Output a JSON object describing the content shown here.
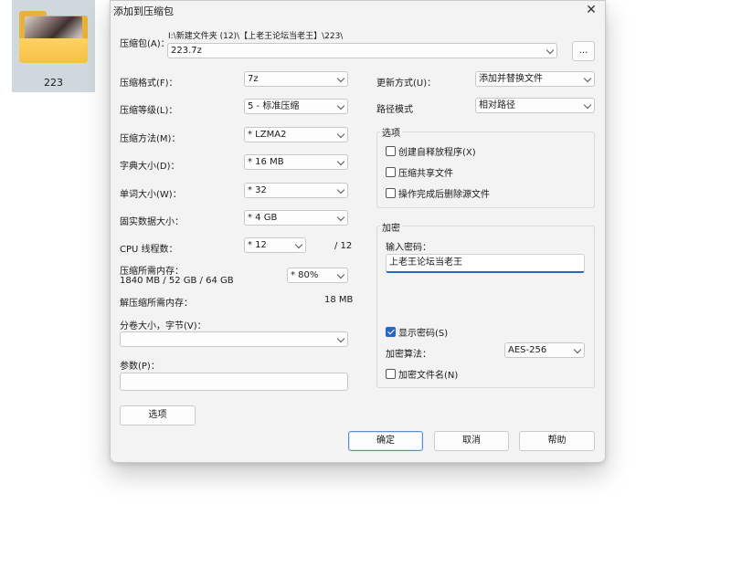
{
  "desktop": {
    "folder_name": "223"
  },
  "dialog": {
    "title": "添加到压缩包",
    "close_glyph": "✕",
    "archive": {
      "label": "压缩包(A)：",
      "path": "I:\\新建文件夹 (12)\\【上老王论坛当老王】\\223\\",
      "name": "223.7z",
      "browse_label": "..."
    },
    "left": {
      "format": {
        "label": "压缩格式(F)：",
        "value": "7z"
      },
      "level": {
        "label": "压缩等级(L)：",
        "value": "5 - 标准压缩"
      },
      "method": {
        "label": "压缩方法(M)：",
        "value": "* LZMA2"
      },
      "dict": {
        "label": "字典大小(D)：",
        "value": "* 16 MB"
      },
      "word": {
        "label": "单词大小(W)：",
        "value": "* 32"
      },
      "solid": {
        "label": "固实数据大小：",
        "value": "* 4 GB"
      },
      "threads": {
        "label": "CPU 线程数：",
        "value": "* 12",
        "max": "/ 12"
      },
      "mem_compress": {
        "label": "压缩所需内存：",
        "detail": "1840 MB / 52 GB / 64 GB",
        "value": "* 80%"
      },
      "mem_decompress": {
        "label": "解压缩所需内存：",
        "value": "18 MB"
      },
      "split": {
        "label": "分卷大小，字节(V)：",
        "value": ""
      },
      "params": {
        "label": "参数(P)：",
        "value": ""
      },
      "options_button": "选项"
    },
    "right": {
      "update": {
        "label": "更新方式(U)：",
        "value": "添加并替换文件"
      },
      "pathmode": {
        "label": "路径模式",
        "value": "相对路径"
      },
      "options": {
        "title": "选项",
        "items": [
          {
            "label": "创建自释放程序(X)",
            "checked": false
          },
          {
            "label": "压缩共享文件",
            "checked": false
          },
          {
            "label": "操作完成后删除源文件",
            "checked": false
          }
        ]
      },
      "encryption": {
        "title": "加密",
        "password_label": "输入密码：",
        "password": "上老王论坛当老王",
        "show_password": {
          "label": "显示密码(S)",
          "checked": true
        },
        "method_label": "加密算法：",
        "method": "AES-256",
        "encrypt_names": {
          "label": "加密文件名(N)",
          "checked": false
        }
      }
    },
    "buttons": {
      "ok": "确定",
      "cancel": "取消",
      "help": "帮助"
    }
  }
}
